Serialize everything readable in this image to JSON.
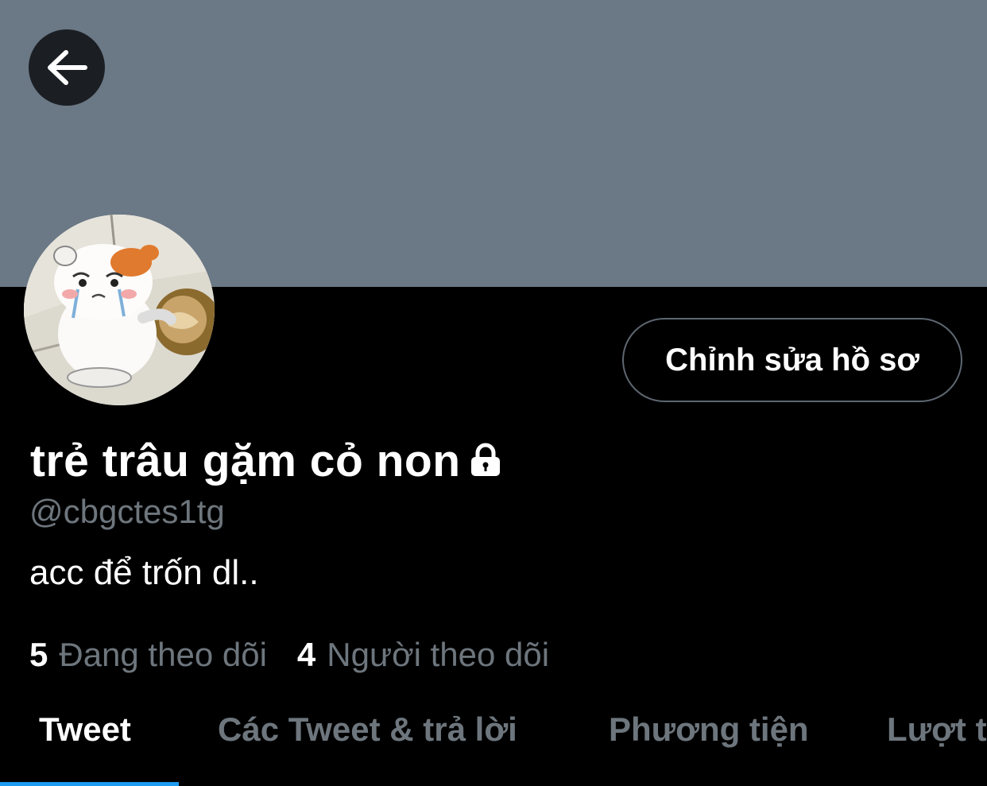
{
  "profile": {
    "display_name": "trẻ trâu gặm cỏ non",
    "handle": "@cbgctes1tg",
    "bio": "acc để trốn dl..",
    "protected": true,
    "banner_color": "#6b7885"
  },
  "actions": {
    "back_icon": "arrow-left-icon",
    "edit_profile_label": "Chỉnh sửa hồ sơ"
  },
  "stats": {
    "following_count": "5",
    "following_label": "Đang theo dõi",
    "followers_count": "4",
    "followers_label": "Người theo dõi"
  },
  "tabs": [
    {
      "label": "Tweet",
      "active": true
    },
    {
      "label": "Các Tweet & trả lời",
      "active": false
    },
    {
      "label": "Phương tiện",
      "active": false
    },
    {
      "label": "Lượt t",
      "active": false
    }
  ],
  "colors": {
    "accent": "#1d9bf0",
    "muted_text": "#6e767d",
    "background": "#000000"
  }
}
